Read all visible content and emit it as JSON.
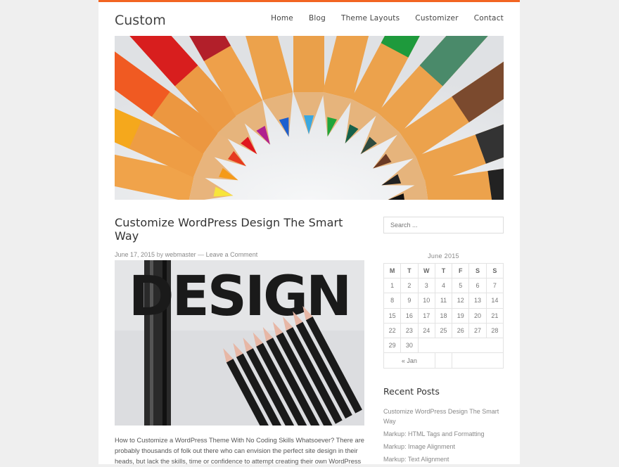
{
  "site": {
    "title": "Custom"
  },
  "nav": {
    "items": [
      "Home",
      "Blog",
      "Theme Layouts",
      "Customizer",
      "Contact"
    ]
  },
  "post": {
    "title": "Customize WordPress Design The Smart Way",
    "date": "June 17, 2015",
    "by": "by",
    "author": "webmaster",
    "separator": "—",
    "comments": "Leave a Comment",
    "featured_text": "DESIGN",
    "excerpt": "How to Customize a WordPress Theme With No Coding Skills Whatsoever?  There are probably thousands of folk out there who can envision the perfect site design in their heads, but lack the skills, time or confidence to attempt creating their own WordPress"
  },
  "sidebar": {
    "search_placeholder": "Search ...",
    "calendar": {
      "caption": "June 2015",
      "headers": [
        "M",
        "T",
        "W",
        "T",
        "F",
        "S",
        "S"
      ],
      "weeks": [
        [
          "1",
          "2",
          "3",
          "4",
          "5",
          "6",
          "7"
        ],
        [
          "8",
          "9",
          "10",
          "11",
          "12",
          "13",
          "14"
        ],
        [
          "15",
          "16",
          "17",
          "18",
          "19",
          "20",
          "21"
        ],
        [
          "22",
          "23",
          "24",
          "25",
          "26",
          "27",
          "28"
        ],
        [
          "29",
          "30",
          "",
          "",
          "",
          "",
          ""
        ]
      ],
      "prev": "« Jan"
    },
    "recent_title": "Recent Posts",
    "recent_posts": [
      "Customize WordPress Design The Smart Way",
      "Markup: HTML Tags and Formatting",
      "Markup: Image Alignment",
      "Markup: Text Alignment"
    ]
  },
  "colors": {
    "accent": "#f26522",
    "background": "#efefef"
  }
}
